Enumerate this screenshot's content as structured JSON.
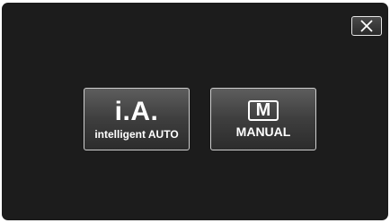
{
  "mode_select": {
    "ia_button": {
      "symbol": "i.A.",
      "label": "intelligent AUTO"
    },
    "manual_button": {
      "icon_letter": "M",
      "label": "MANUAL"
    },
    "close_icon": "close-icon"
  },
  "colors": {
    "background": "#1c1c1c",
    "button_border": "#cfcfcf",
    "text": "#ffffff"
  }
}
